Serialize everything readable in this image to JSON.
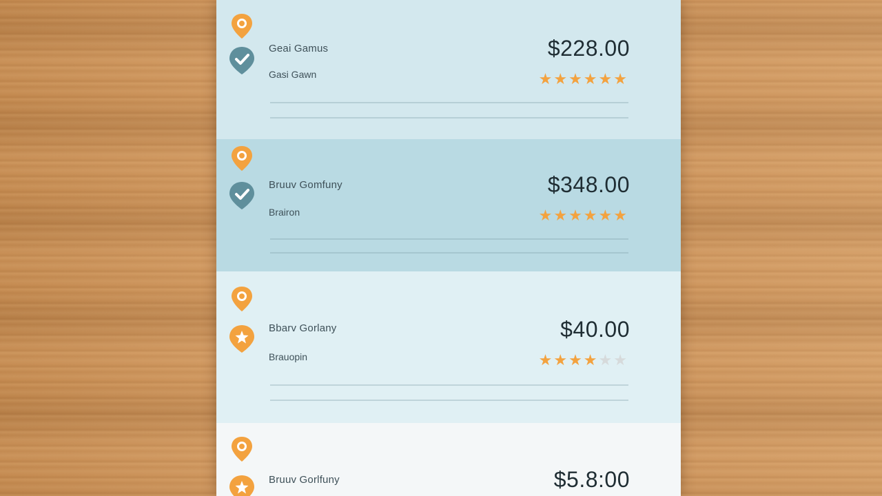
{
  "colors": {
    "accent_orange": "#f3a23f",
    "check_badge": "#5f8f9c",
    "text_dark": "#1f2d33"
  },
  "listings": [
    {
      "name": "Geai Gamus",
      "subtitle": "Gasi Gawn",
      "price": "$228.00",
      "rating": 6,
      "rating_max": 6,
      "badge_icon": "checkmark-icon",
      "background": "#d3e8ee"
    },
    {
      "name": "Bruuv Gomfuny",
      "subtitle": "Brairon",
      "price": "$348.00",
      "rating": 6,
      "rating_max": 6,
      "badge_icon": "checkmark-icon",
      "background": "#b9dae3"
    },
    {
      "name": "Bbarv Gorlany",
      "subtitle": "Brauopin",
      "price": "$40.00",
      "rating": 4,
      "rating_max": 6,
      "badge_icon": "star-badge-icon",
      "background": "#e0f0f4"
    },
    {
      "name": "Bruuv Gorlfuny",
      "subtitle": "",
      "price": "$5.8:00",
      "rating": 0,
      "rating_max": 6,
      "badge_icon": "star-badge-icon",
      "background": "#f4f7f8"
    }
  ]
}
